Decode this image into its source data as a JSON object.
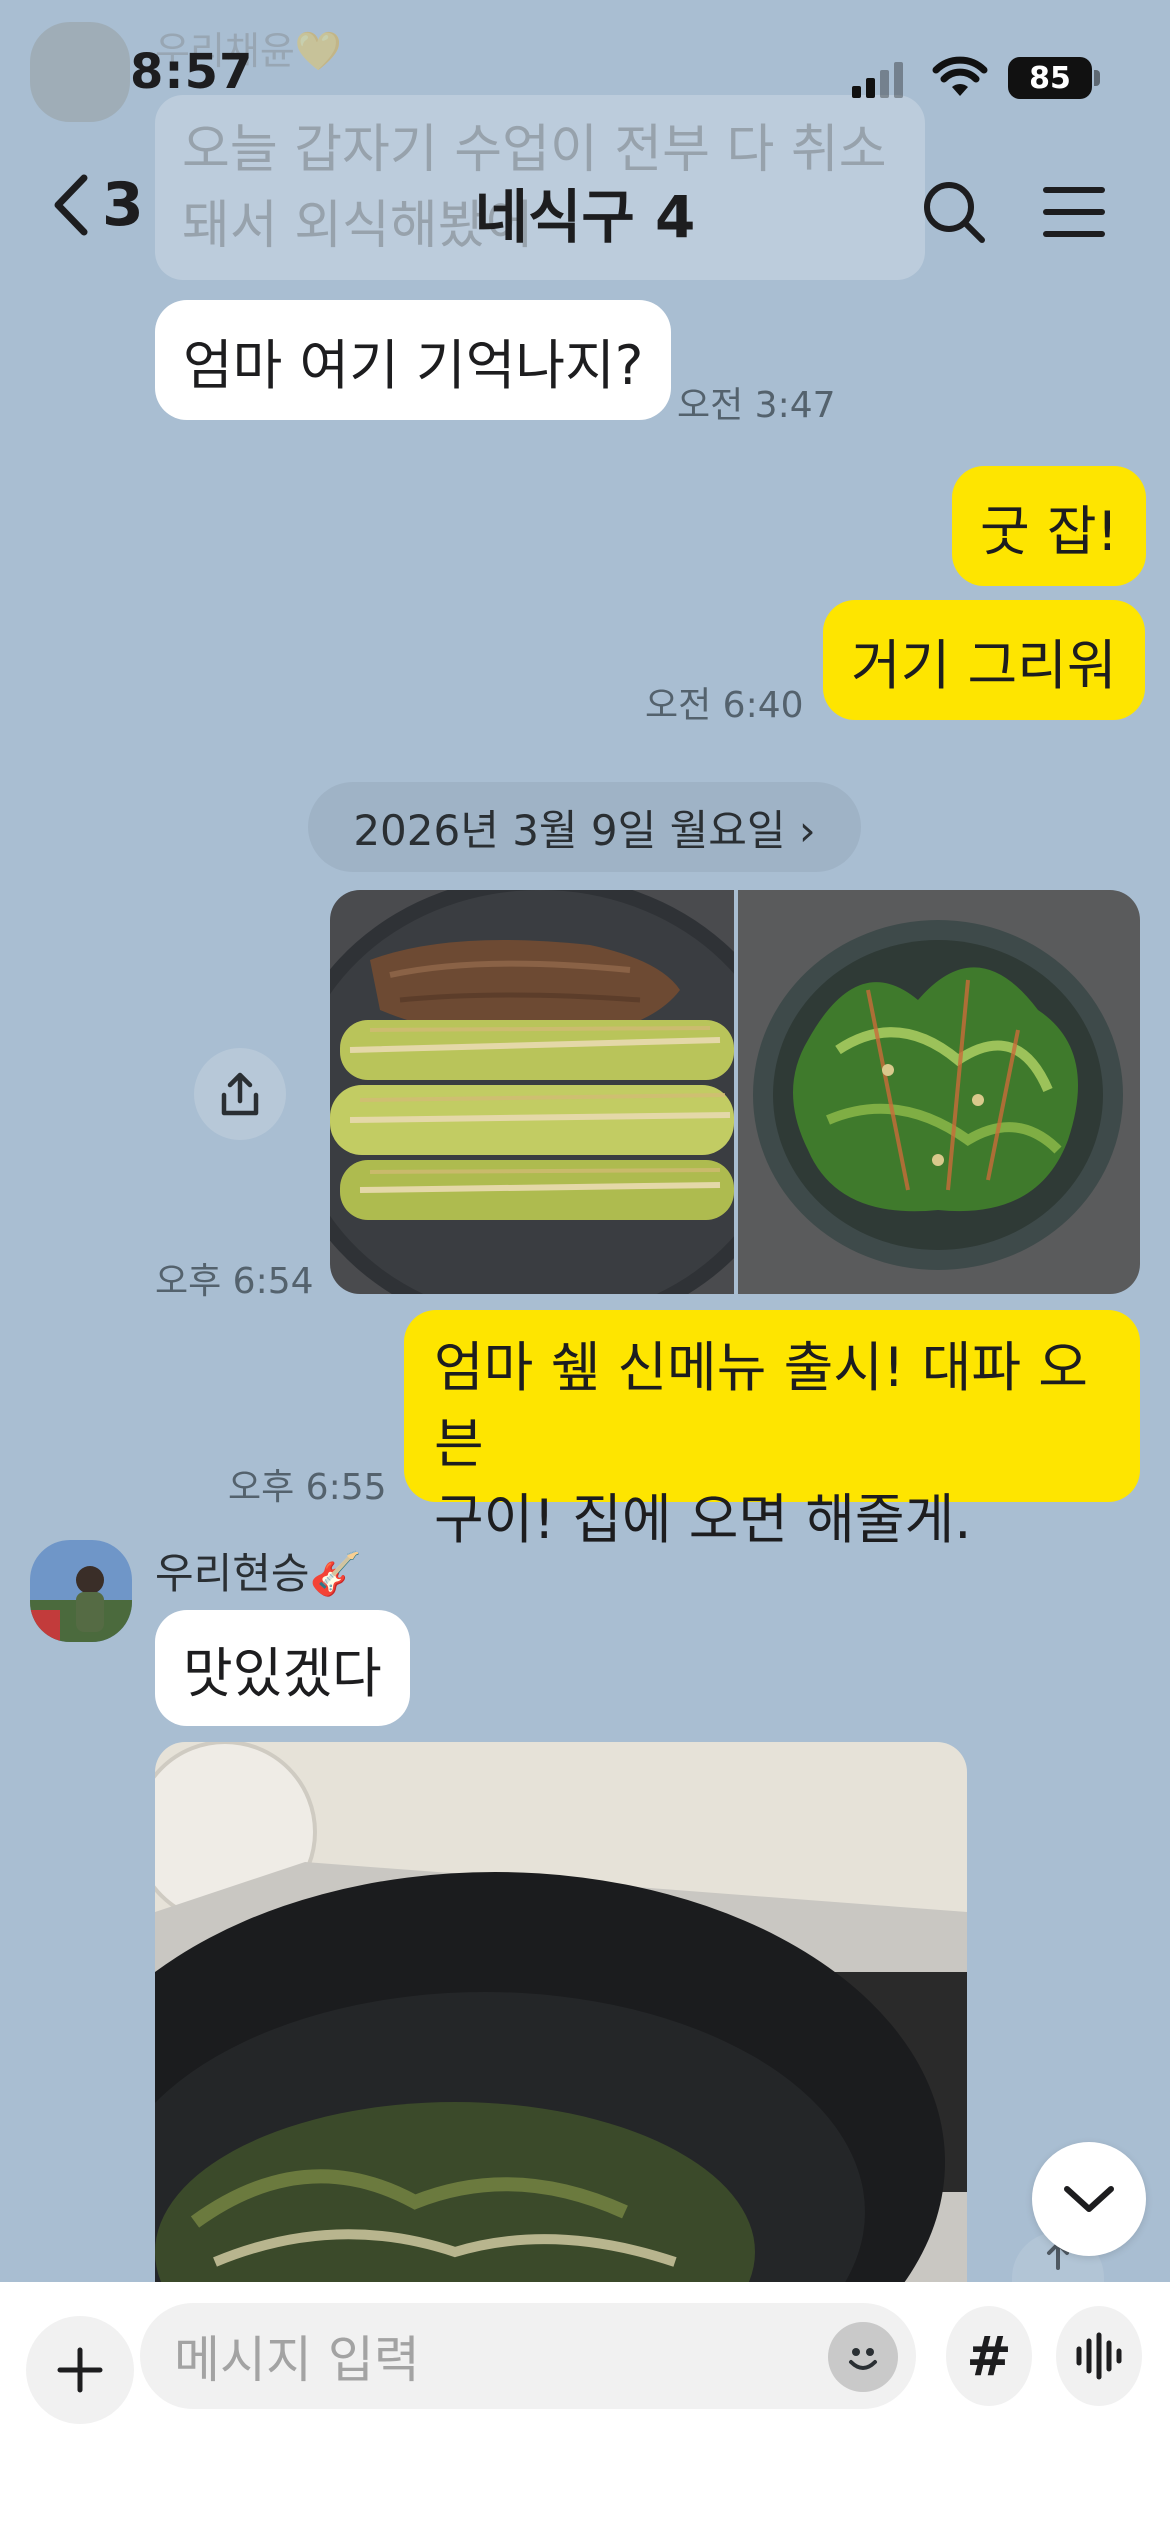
{
  "status_bar": {
    "time": "8:57",
    "battery": "85"
  },
  "header": {
    "back_count": "3",
    "title": "네식구 4"
  },
  "previous": {
    "sender": "우리채윤💛",
    "text": "오늘 갑자기 수업이 전부 다 취소돼서 외식해봤어"
  },
  "messages": {
    "m1": {
      "text": "엄마 여기 기억나지?",
      "time": "오전 3:47"
    },
    "m2": {
      "text": "굿 잡!"
    },
    "m3": {
      "text": "거기 그리워",
      "time": "오전 6:40"
    },
    "date_divider": "2026년 3월 9일 월요일 ›",
    "photos": {
      "time": "오후 6:54"
    },
    "m4": {
      "line1": "엄마 쉪 신메뉴 출시! 대파 오븐",
      "line2": "구이! 집에 오면 해줄게.",
      "time": "오후 6:55"
    },
    "sender2": "우리현승🎸",
    "m5": {
      "text": "맛있겠다"
    }
  },
  "input": {
    "placeholder": "메시지 입력"
  },
  "icons": {
    "back": "chevron-left-icon",
    "search": "search-icon",
    "menu": "menu-icon",
    "share": "share-icon",
    "scroll": "chevron-down-icon",
    "plus": "plus-icon",
    "emoji": "emoji-icon",
    "hash": "hash-icon",
    "voice": "voice-icon"
  },
  "colors": {
    "background": "#a9bed2",
    "outgoing_bubble": "#fee500",
    "incoming_bubble": "#ffffff"
  }
}
